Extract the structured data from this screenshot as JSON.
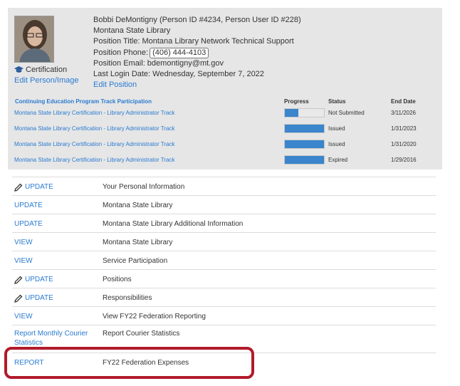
{
  "profile": {
    "name_line": "Bobbi DeMontigny (Person ID #4234, Person User ID #228)",
    "library": "Montana State Library",
    "position_title": "Position Title: Montana Library Network Technical Support",
    "phone_label": "Position Phone:",
    "phone_value": "(406) 444-4103",
    "email": "Position Email: bdemontigny@mt.gov",
    "last_login": "Last Login Date: Wednesday, September 7, 2022",
    "edit_position": "Edit Position",
    "certification": "Certification",
    "edit_person": "Edit Person/Image"
  },
  "tracks": {
    "header": {
      "title": "Continuing Education Program Track Participation",
      "progress": "Progress",
      "status": "Status",
      "end_date": "End Date"
    },
    "rows": [
      {
        "name": "Montana State Library Certification - Library Administrator Track",
        "progress": 0.35,
        "status": "Not Submitted",
        "end_date": "3/11/2026"
      },
      {
        "name": "Montana State Library Certification - Library Administrator Track",
        "progress": 1.0,
        "status": "Issued",
        "end_date": "1/31/2023"
      },
      {
        "name": "Montana State Library Certification - Library Administrator Track",
        "progress": 1.0,
        "status": "Issued",
        "end_date": "1/31/2020"
      },
      {
        "name": "Montana State Library Certification - Library Administrator Track",
        "progress": 1.0,
        "status": "Expired",
        "end_date": "1/29/2016"
      }
    ]
  },
  "actions": [
    {
      "label": "UPDATE",
      "icon": "pencil-icon",
      "desc": "Your Personal Information"
    },
    {
      "label": "UPDATE",
      "icon": "",
      "desc": "Montana State Library"
    },
    {
      "label": "UPDATE",
      "icon": "",
      "desc": "Montana State Library Additional Information"
    },
    {
      "label": "VIEW",
      "icon": "",
      "desc": "Montana State Library"
    },
    {
      "label": "VIEW",
      "icon": "",
      "desc": "Service Participation"
    },
    {
      "label": "UPDATE",
      "icon": "pencil-icon",
      "desc": "Positions"
    },
    {
      "label": "UPDATE",
      "icon": "pencil-icon",
      "desc": "Responsibilities"
    },
    {
      "label": "VIEW",
      "icon": "",
      "desc": "View FY22 Federation Reporting"
    },
    {
      "label": "Report Monthly Courier Statistics",
      "icon": "",
      "desc": "Report Courier Statistics"
    },
    {
      "label": "REPORT",
      "icon": "",
      "desc": "FY22 Federation Expenses"
    }
  ],
  "colors": {
    "link": "#2a7bd1",
    "highlight": "#b11a2b",
    "progress": "#3a85cc"
  }
}
